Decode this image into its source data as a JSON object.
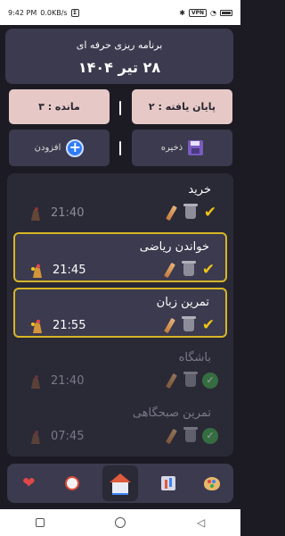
{
  "status_bar": {
    "time": "9:42 PM",
    "speed": "0.0KB/s",
    "notif_badge": "Σ",
    "vpn": "VPN",
    "battery_label": "battery"
  },
  "header": {
    "title": "برنامه ریزی حرفه ای",
    "date": "۲۸ تیر ۱۴۰۴"
  },
  "stats": {
    "done_label": "پایان یافته : ۲",
    "left_label": "مانده : ۳"
  },
  "actions": {
    "save_label": "ذخیره",
    "add_label": "افزودن"
  },
  "tasks": [
    {
      "name": "خرید",
      "time": "21:40",
      "state": "dim-alarm",
      "done": false
    },
    {
      "name": "خواندن ریاضی",
      "time": "21:45",
      "state": "highlighted",
      "done": false
    },
    {
      "name": "تمرین زبان",
      "time": "21:55",
      "state": "highlighted",
      "done": false
    },
    {
      "name": "باشگاه",
      "time": "21:40",
      "state": "completed",
      "done": true
    },
    {
      "name": "تمرین صبحگاهی",
      "time": "07:45",
      "state": "completed",
      "done": true
    }
  ],
  "tabs": [
    {
      "icon": "heart-icon"
    },
    {
      "icon": "alarm-clock-icon"
    },
    {
      "icon": "home-icon"
    },
    {
      "icon": "chart-icon"
    },
    {
      "icon": "palette-icon"
    }
  ],
  "colors": {
    "background": "#1c1b24",
    "card": "#3b3a4e",
    "stat_card": "#e6c9c7",
    "highlight_border": "#d7b626",
    "accent_blue": "#2f7cf6",
    "done_green": "#3fa64a"
  }
}
